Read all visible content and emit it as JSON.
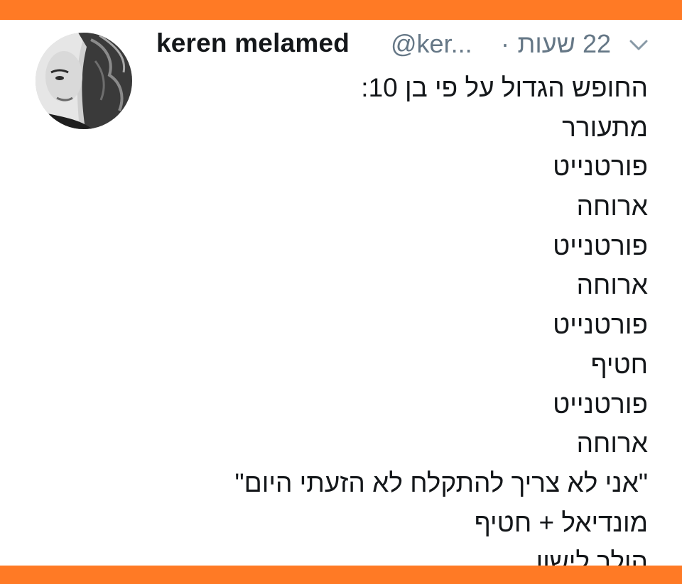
{
  "colors": {
    "frame_accent": "#ff7a25",
    "text_primary": "#14171a",
    "text_secondary": "#657786"
  },
  "tweet": {
    "avatar_icon": "profile-photo",
    "author_name": "keren melamed",
    "author_handle": "@ker...",
    "separator": "·",
    "timestamp": "22 שעות",
    "menu_icon": "chevron-down-icon",
    "lines": [
      "החופש הגדול על פי בן 10:",
      "מתעורר",
      "פורטנייט",
      "ארוחה",
      "פורטנייט",
      "ארוחה",
      "פורטנייט",
      "חטיף",
      "פורטנייט",
      "ארוחה",
      "\"אני לא צריך להתקלח לא הזעתי היום\"",
      "מונדיאל + חטיף",
      "הולך לישון"
    ]
  }
}
